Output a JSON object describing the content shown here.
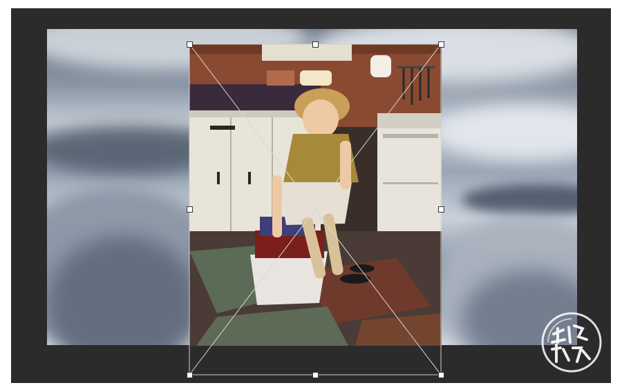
{
  "document": {
    "background_layer": "clouds",
    "foreground_layer": "kitchen-photo"
  },
  "transform": {
    "handles": [
      "top-left",
      "top-center",
      "top-right",
      "middle-left",
      "middle-right",
      "bottom-left",
      "bottom-center",
      "bottom-right"
    ]
  },
  "watermark": {
    "text": "创意炒饭"
  },
  "colors": {
    "workspace": "#2b2b2b",
    "handle": "#ffffff"
  }
}
